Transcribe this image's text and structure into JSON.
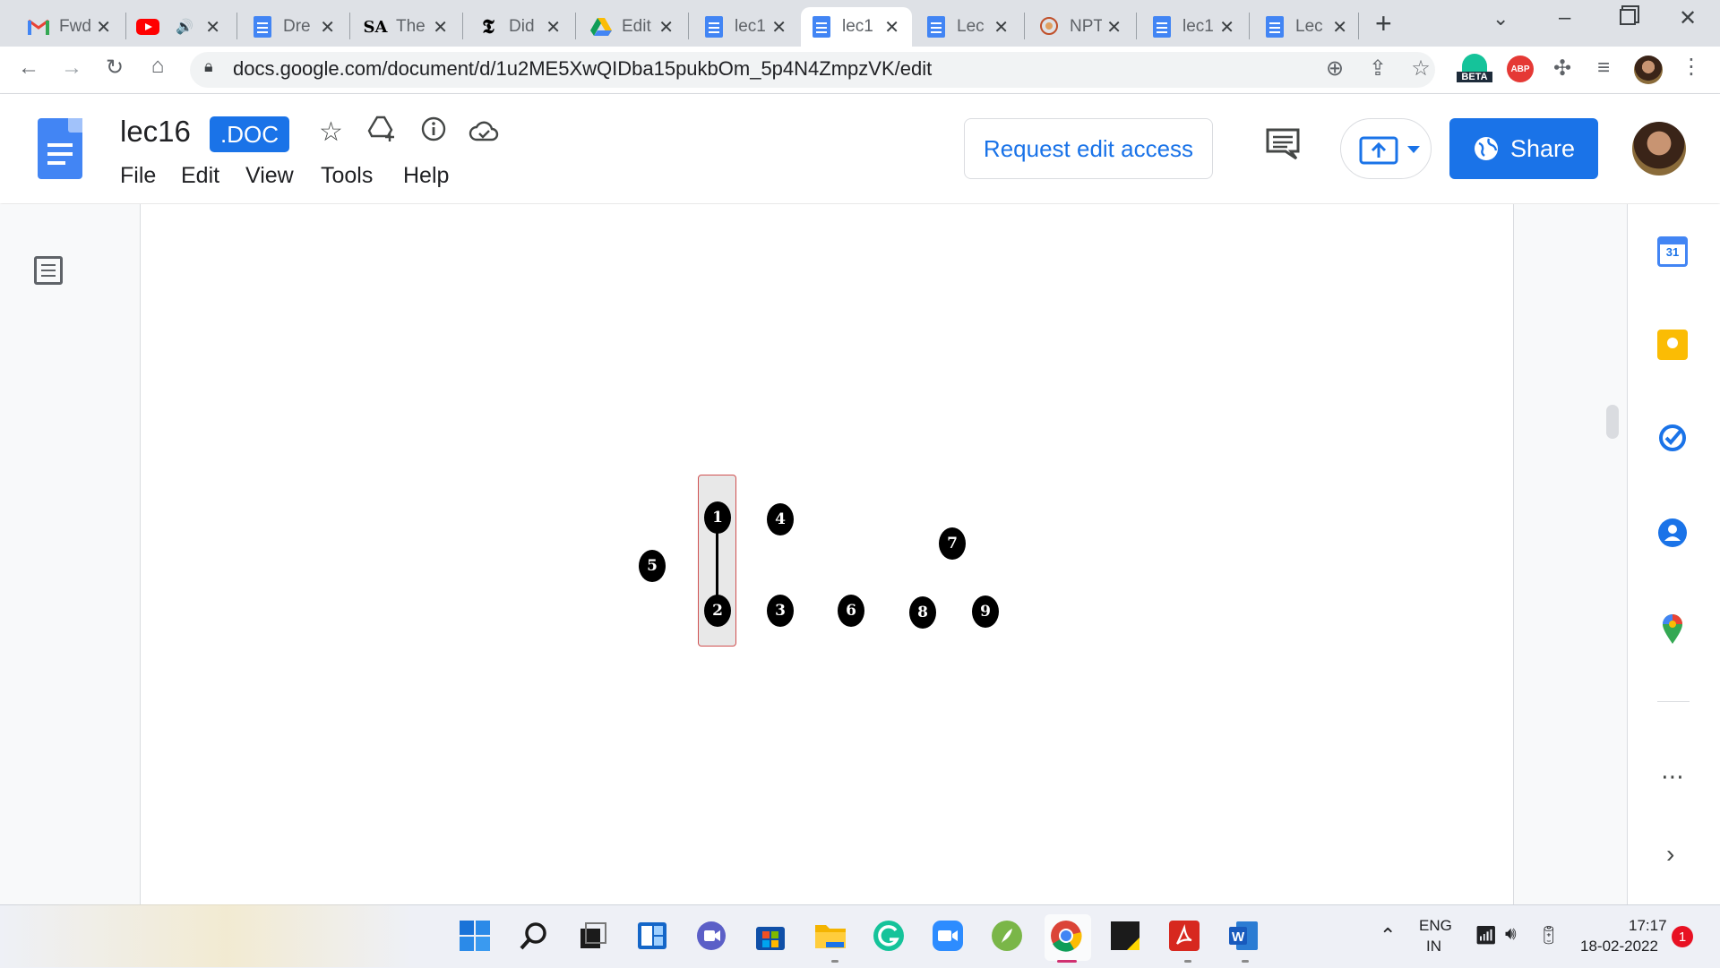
{
  "browser": {
    "tabs": [
      {
        "title": "Fwd",
        "icon": "gmail-icon",
        "active": false
      },
      {
        "title": "",
        "icon": "youtube-icon",
        "active": false,
        "audio": true
      },
      {
        "title": "Dre",
        "icon": "docs-icon",
        "active": false
      },
      {
        "title": "The",
        "icon": "sa-icon",
        "active": false
      },
      {
        "title": "Did",
        "icon": "nyt-icon",
        "active": false
      },
      {
        "title": "Edit",
        "icon": "drive-icon",
        "active": false
      },
      {
        "title": "lec1",
        "icon": "docs-icon",
        "active": false
      },
      {
        "title": "lec1",
        "icon": "docs-icon",
        "active": true
      },
      {
        "title": "Lec",
        "icon": "docs-icon",
        "active": false
      },
      {
        "title": "NPT",
        "icon": "nptel-icon",
        "active": false
      },
      {
        "title": "lec1",
        "icon": "docs-icon",
        "active": false
      },
      {
        "title": "Lec",
        "icon": "docs-icon",
        "active": false
      }
    ],
    "url": "docs.google.com/document/d/1u2ME5XwQIDba15pukbOm_5p4N4ZmpzVK/edit",
    "extensions": {
      "beta_label": "BETA",
      "abp_label": "ABP"
    }
  },
  "doc": {
    "title": "lec16",
    "badge": ".DOC",
    "menus": [
      "File",
      "Edit",
      "View",
      "Tools",
      "Help"
    ],
    "request_edit": "Request edit access",
    "share": "Share"
  },
  "graph": {
    "nodes": [
      {
        "label": "1"
      },
      {
        "label": "2"
      },
      {
        "label": "3"
      },
      {
        "label": "4"
      },
      {
        "label": "5"
      },
      {
        "label": "6"
      },
      {
        "label": "7"
      },
      {
        "label": "8"
      },
      {
        "label": "9"
      }
    ],
    "edges": [
      [
        "1",
        "2"
      ]
    ],
    "selected": [
      "1",
      "2"
    ]
  },
  "side_panel": [
    "calendar-icon",
    "keep-icon",
    "tasks-icon",
    "contacts-icon",
    "maps-icon"
  ],
  "side_calendar_day": "31",
  "taskbar": {
    "lang": "ENG",
    "region": "IN",
    "time": "17:17",
    "date": "18-02-2022",
    "notifications": "1"
  },
  "colors": {
    "accent": "#1a73e8",
    "tabstrip": "#dee1e6",
    "taskbar": "#eef0f6"
  }
}
